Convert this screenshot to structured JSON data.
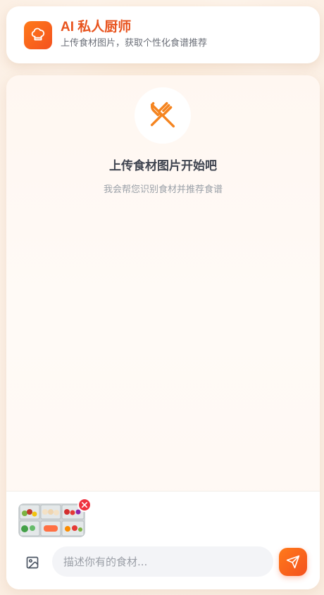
{
  "header": {
    "title": "AI 私人厨师",
    "subtitle": "上传食材图片，获取个性化食谱推荐",
    "logo_icon": "chef-hat-icon"
  },
  "empty_state": {
    "icon": "fork-knife-icon",
    "title": "上传食材图片开始吧",
    "hint": "我会帮您识别食材并推荐食谱"
  },
  "composer": {
    "attachment": {
      "icon": "image-thumbnail",
      "remove_icon": "close-icon"
    },
    "image_button_icon": "image-icon",
    "input_placeholder": "描述你有的食材...",
    "input_value": "",
    "send_icon": "send-icon"
  },
  "colors": {
    "accent": "#f4511e",
    "accent_light": "#ff7a1a",
    "danger": "#ef3340",
    "text_dark": "#3f4450",
    "text_muted": "#9aa0a8"
  }
}
